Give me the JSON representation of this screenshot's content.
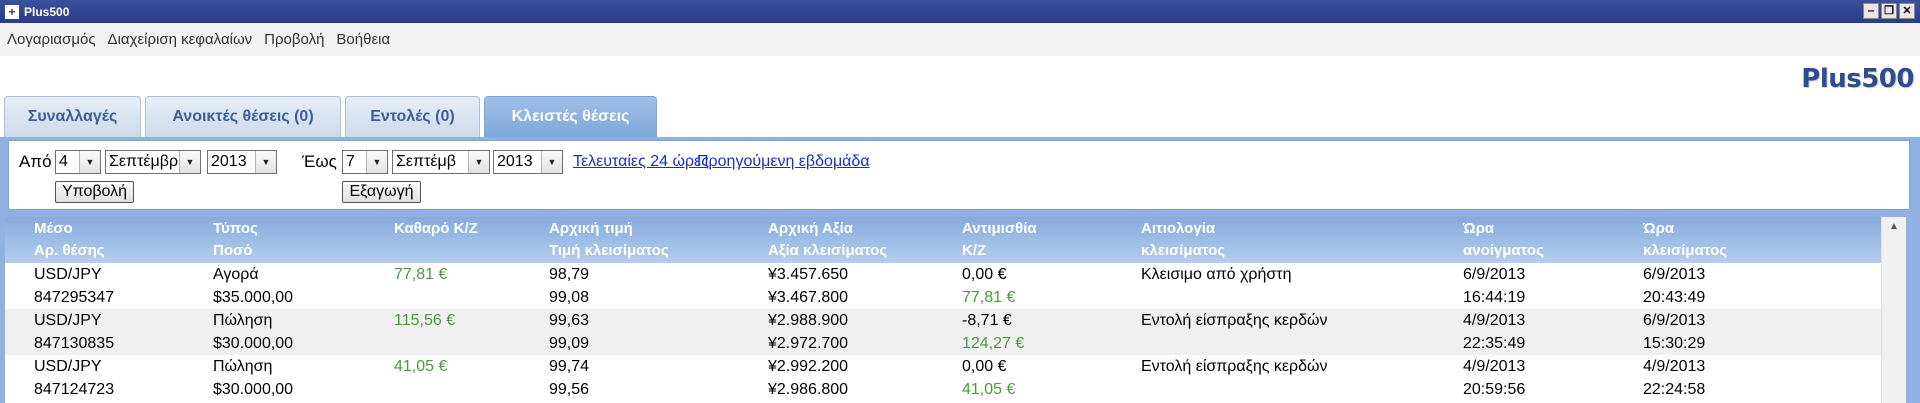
{
  "window": {
    "title": "Plus500",
    "minimize": "‒",
    "restore": "❐",
    "close": "✕"
  },
  "menu": [
    "Λογαριασμός",
    "Διαχείριση κεφαλαίων",
    "Προβολή",
    "Βοήθεια"
  ],
  "logo": "Plus500",
  "tabs": [
    {
      "label": "Συναλλαγές",
      "active": false
    },
    {
      "label": "Ανοικτές θέσεις (0)",
      "active": false
    },
    {
      "label": "Εντολές (0)",
      "active": false
    },
    {
      "label": "Κλειστές θέσεις",
      "active": true
    }
  ],
  "filter": {
    "from_label": "Από",
    "from_day": "4",
    "from_month": "Σεπτέμβρ",
    "from_year": "2013",
    "to_label": "Έως",
    "to_day": "7",
    "to_month": "Σεπτέμβ",
    "to_year": "2013",
    "submit_label": "Υποβολή",
    "export_label": "Εξαγωγή",
    "last24_link": "Τελευταίες 24 ώρες",
    "prev_week_link": "Προηγούμενη εβδομάδα"
  },
  "table": {
    "headers": [
      [
        "Μέσο",
        "Αρ. θέσης"
      ],
      [
        "Τύπος",
        "Ποσό"
      ],
      [
        "Καθαρό Κ/Ζ",
        ""
      ],
      [
        "Αρχική τιμή",
        "Τιμή κλεισίματος"
      ],
      [
        "Αρχική Αξία",
        "Αξία κλεισίματος"
      ],
      [
        "Αντιμισθία",
        "Κ/Ζ"
      ],
      [
        "Αιτιολογία",
        "κλεισίματος"
      ],
      [
        "Ώρα",
        "ανοίγματος"
      ],
      [
        "Ώρα",
        "κλεισίματος"
      ]
    ],
    "rows": [
      {
        "instrument": "USD/JPY",
        "position_no": "847295347",
        "type": "Αγορά",
        "amount": "$35.000,00",
        "net_pl": "77,81 €",
        "open_price": "98,79",
        "close_price": "99,08",
        "open_value": "¥3.457.650",
        "close_value": "¥3.467.800",
        "commission": "0,00 €",
        "pl": "77,81 €",
        "close_reason": "Κλεισιμο από χρήστη",
        "open_date": "6/9/2013",
        "open_time": "16:44:19",
        "close_date": "6/9/2013",
        "close_time": "20:43:49"
      },
      {
        "instrument": "USD/JPY",
        "position_no": "847130835",
        "type": "Πώληση",
        "amount": "$30.000,00",
        "net_pl": "115,56 €",
        "open_price": "99,63",
        "close_price": "99,09",
        "open_value": "¥2.988.900",
        "close_value": "¥2.972.700",
        "commission": "-8,71 €",
        "pl": "124,27 €",
        "close_reason": "Εντολή είσπραξης κερδών",
        "open_date": "4/9/2013",
        "open_time": "22:35:49",
        "close_date": "6/9/2013",
        "close_time": "15:30:29"
      },
      {
        "instrument": "USD/JPY",
        "position_no": "847124723",
        "type": "Πώληση",
        "amount": "$30.000,00",
        "net_pl": "41,05 €",
        "open_price": "99,74",
        "close_price": "99,56",
        "open_value": "¥2.992.200",
        "close_value": "¥2.986.800",
        "commission": "0,00 €",
        "pl": "41,05 €",
        "close_reason": "Εντολή είσπραξης κερδών",
        "open_date": "4/9/2013",
        "open_time": "20:59:56",
        "close_date": "4/9/2013",
        "close_time": "22:24:58"
      }
    ]
  },
  "colors": {
    "accent": "#2a3c85",
    "tab_active": "#8fb2e0",
    "profit": "#4b9b3e",
    "link": "#1a2fcc"
  }
}
